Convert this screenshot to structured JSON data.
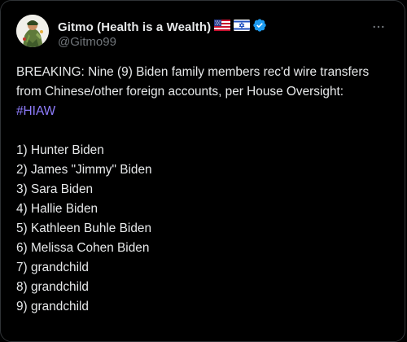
{
  "author": {
    "display_name": "Gitmo (Health is a Wealth)",
    "handle": "@Gitmo99",
    "flags": [
      "us-flag-icon",
      "israel-flag-icon"
    ],
    "verified_badge": "verified-badge-icon"
  },
  "tweet": {
    "intro": "BREAKING: Nine (9) Biden family members rec'd wire transfers from Chinese/other foreign accounts, per House Oversight:",
    "hashtag": "#HIAW",
    "list": [
      "1) Hunter Biden",
      "2) James \"Jimmy\" Biden",
      "3) Sara Biden",
      "4) Hallie Biden",
      "5) Kathleen Buhle Biden",
      "6) Melissa Cohen Biden",
      "7) grandchild",
      "8) grandchild",
      "9) grandchild"
    ]
  },
  "colors": {
    "background": "#000000",
    "text": "#e7e9ea",
    "secondary_text": "#71767b",
    "hashtag": "#8f7dff",
    "verified": "#1d9bf0",
    "border": "#2f3336"
  },
  "icons": {
    "more": "more-options-icon"
  }
}
